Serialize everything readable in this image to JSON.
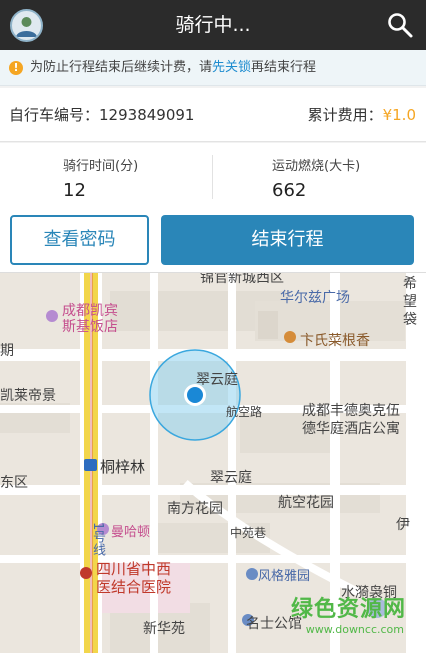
{
  "header": {
    "title": "骑行中..."
  },
  "notice": {
    "prefix": "为防止行程结束后继续计费，请",
    "link": "先关锁",
    "suffix": "再结束行程"
  },
  "bike": {
    "label": "自行车编号：",
    "number": "1293849091",
    "fee_label": "累计费用：",
    "fee_value": "¥1.0"
  },
  "stats": [
    {
      "label": "骑行时间(分)",
      "value": "12"
    },
    {
      "label": "运动燃烧(大卡)",
      "value": "662"
    }
  ],
  "buttons": {
    "view_password": "查看密码",
    "end_trip": "结束行程"
  },
  "map": {
    "labels": {
      "l1": "锦官新城西区",
      "l2": "华尔兹广场",
      "l3": "成都凯宾",
      "l4": "斯基饭店",
      "l5": "卞氏菜根香",
      "l6": "翠云庭",
      "l7": "期",
      "l8": "凯莱帝景",
      "l9": "航空路",
      "l10": "成都丰德奥克伍",
      "l11": "德华庭酒店公寓",
      "l12": "桐梓林",
      "l13": "翠云庭",
      "l14": "东区",
      "l15": "南方花园",
      "l16": "航空花园",
      "l17": "曼哈顿",
      "l18": "中苑巷",
      "l19": "四川省中西",
      "l20": "医结合医院",
      "l21": "风格雅园",
      "l22": "水漪袅铜",
      "l23": "新华苑",
      "l24": "名士公馆",
      "l25": "1号线",
      "l26": "伊",
      "l27": "希",
      "l28": "望",
      "l29": "袋"
    },
    "watermark": "绿色资源网",
    "watermark_url": "www.downcc.com"
  }
}
